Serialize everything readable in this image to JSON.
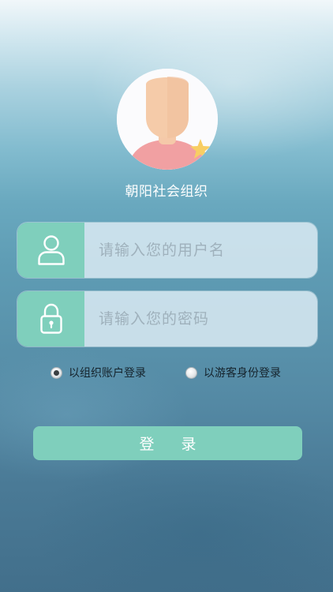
{
  "profile": {
    "avatar_icon": "default-user-avatar",
    "org_name": "朝阳社会组织"
  },
  "form": {
    "username": {
      "icon": "user-icon",
      "placeholder": "请输入您的用户名",
      "value": ""
    },
    "password": {
      "icon": "lock-icon",
      "placeholder": "请输入您的密码",
      "value": ""
    },
    "login_mode": {
      "options": [
        {
          "label": "以组织账户登录",
          "selected": true
        },
        {
          "label": "以游客身份登录",
          "selected": false
        }
      ]
    },
    "submit_label": "登 录"
  },
  "colors": {
    "accent": "#7fcfbc",
    "input_bg": "#d7e8f1",
    "placeholder": "#9fb1bc"
  }
}
